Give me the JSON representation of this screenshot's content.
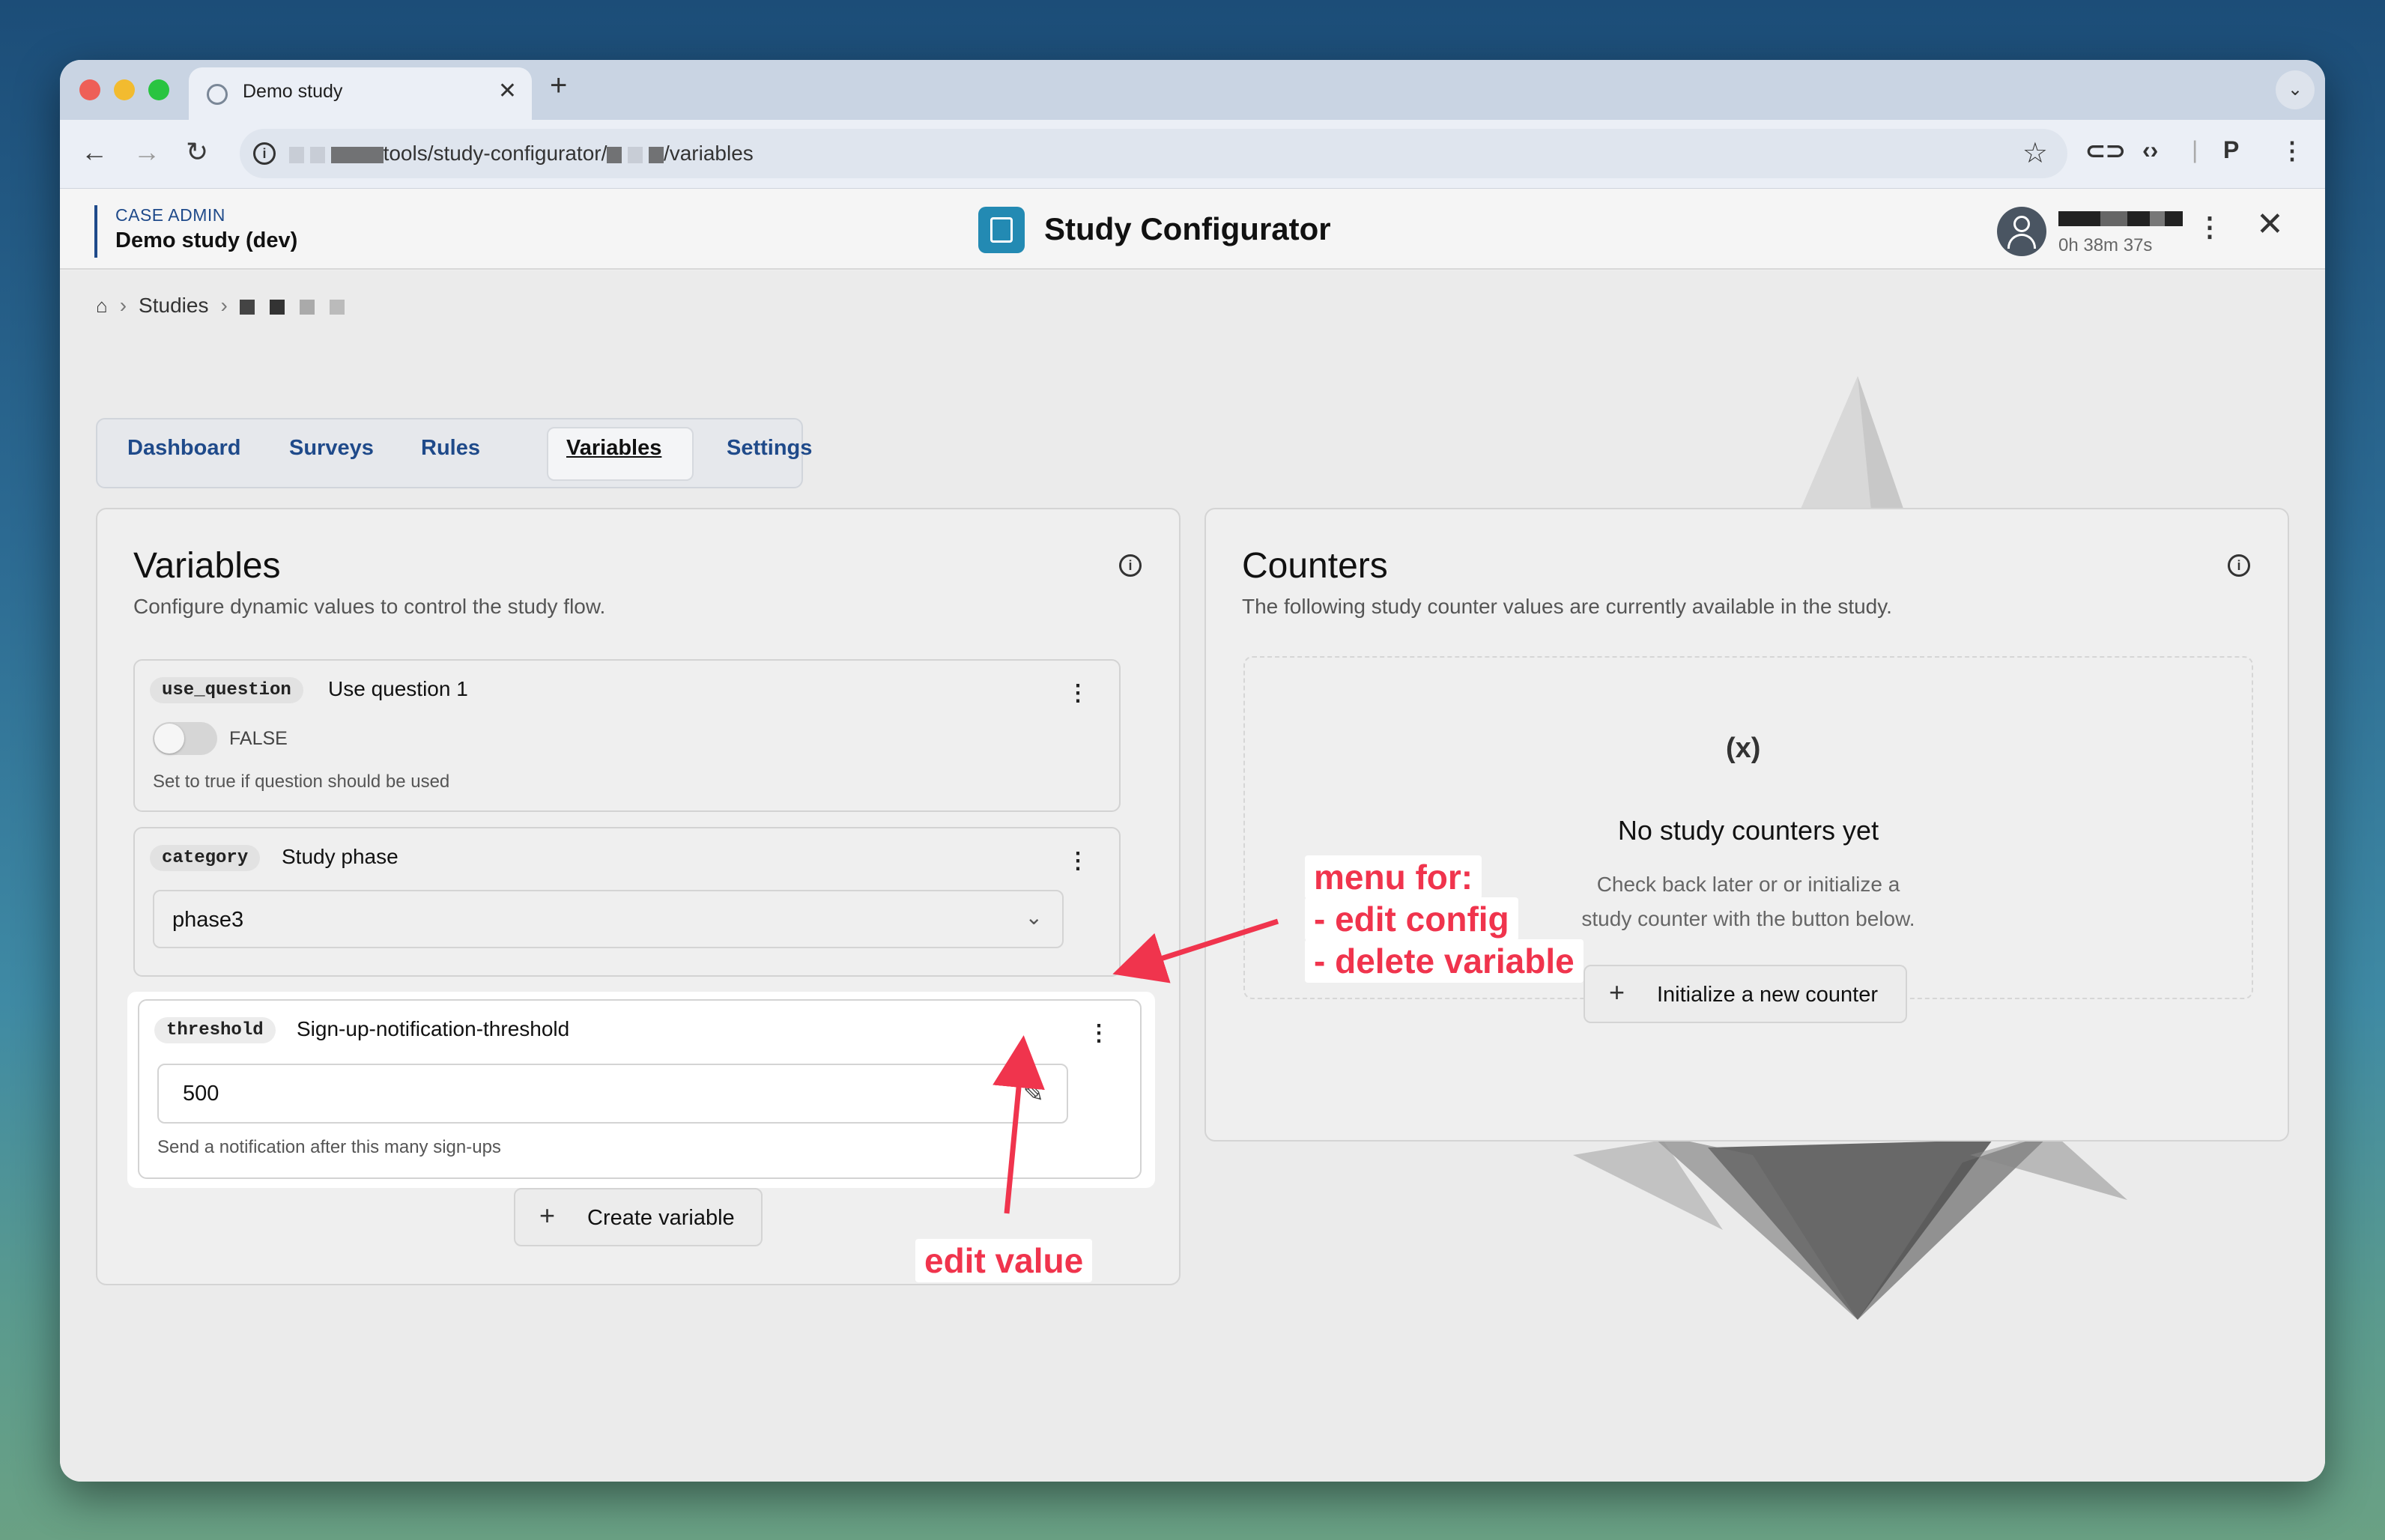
{
  "browser": {
    "tab_title": "Demo study",
    "url_path_part": "tools/study-configurator/",
    "url_suffix": "/variables"
  },
  "header": {
    "case_label": "CASE ADMIN",
    "case_name": "Demo study (dev)",
    "app_title": "Study Configurator",
    "session_time": "0h 38m 37s"
  },
  "breadcrumb": {
    "studies": "Studies"
  },
  "tabs": [
    {
      "label": "Dashboard"
    },
    {
      "label": "Surveys"
    },
    {
      "label": "Rules"
    },
    {
      "label": "Variables",
      "active": true
    },
    {
      "label": "Settings"
    }
  ],
  "variables": {
    "title": "Variables",
    "subtitle": "Configure dynamic values to control the study flow.",
    "items": [
      {
        "key": "use_question",
        "label": "Use question 1",
        "toggle_value": "FALSE",
        "description": "Set to true if question should be used"
      },
      {
        "key": "category",
        "label": "Study phase",
        "selected": "phase3"
      },
      {
        "key": "threshold",
        "label": "Sign-up-notification-threshold",
        "value": "500",
        "description": "Send a notification after this many sign-ups"
      }
    ],
    "create_button": "Create variable"
  },
  "counters": {
    "title": "Counters",
    "subtitle": "The following study counter values are currently available in the study.",
    "icon_text": "(x)",
    "empty_title": "No study counters yet",
    "empty_text_line1": "Check back later or or initialize a",
    "empty_text_line2": "study counter with the button below.",
    "init_button": "Initialize a new counter"
  },
  "annotations": {
    "menu_line1": "menu for:",
    "menu_line2": "- edit config",
    "menu_line3": "- delete variable",
    "edit_value": "edit value",
    "color": "#f0344d"
  }
}
